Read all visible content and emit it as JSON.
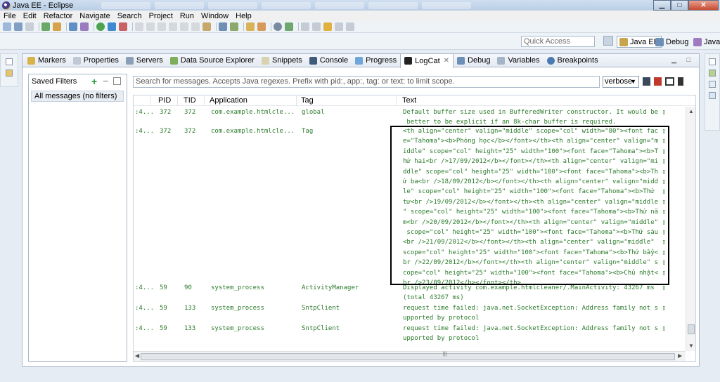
{
  "window": {
    "title": "Java EE - Eclipse",
    "min": "▁",
    "max": "□",
    "close": "✕"
  },
  "menu": [
    "File",
    "Edit",
    "Refactor",
    "Navigate",
    "Search",
    "Project",
    "Run",
    "Window",
    "Help"
  ],
  "toolbar": {
    "quick_access": "Quick Access"
  },
  "perspectives": {
    "javaee": "Java EE",
    "debug": "Debug",
    "java": "Java"
  },
  "view_tabs": [
    "Markers",
    "Properties",
    "Servers",
    "Data Source Explorer",
    "Snippets",
    "Console",
    "Progress",
    "LogCat",
    "Debug",
    "Variables",
    "Breakpoints"
  ],
  "logcat": {
    "saved_filters_label": "Saved Filters",
    "filter_item": "All messages (no filters)",
    "search_placeholder": "Search for messages. Accepts Java regexes. Prefix with pid:, app:, tag: or text: to limit scope.",
    "log_level": "verbose",
    "columns": {
      "pid": "PID",
      "tid": "TID",
      "application": "Application",
      "tag": "Tag",
      "text": "Text"
    },
    "rows": [
      {
        "time": ":4...",
        "pid": "372",
        "tid": "372",
        "app": "com.example.htmlcle...",
        "tag": "global",
        "lines": [
          "Default buffer size used in BufferedWriter constructor. It would be ▯",
          " better to be explicit if an 8k-char buffer is required."
        ]
      },
      {
        "time": ":4...",
        "pid": "372",
        "tid": "372",
        "app": "com.example.htmlcle...",
        "tag": "Tag",
        "lines": [
          "<th align=\"center\" valign=\"middle\" scope=\"col\" width=\"80\"><font fac ▯",
          "e=\"Tahoma\"><b>Phòng học</b></font></th><th align=\"center\" valign=\"m ▯",
          "iddle\" scope=\"col\" height=\"25\" width=\"100\"><font face=\"Tahoma\"><b>T ▯",
          "hứ hai<br />17/09/2012</b></font></th><th align=\"center\" valign=\"mi ▯",
          "ddle\" scope=\"col\" height=\"25\" width=\"100\"><font face=\"Tahoma\"><b>Th ▯",
          "ứ ba<br />18/09/2012</b></font></th><th align=\"center\" valign=\"midd ▯",
          "le\" scope=\"col\" height=\"25\" width=\"100\"><font face=\"Tahoma\"><b>Thứ  ▯",
          "tư<br />19/09/2012</b></font></th><th align=\"center\" valign=\"middle ▯",
          "\" scope=\"col\" height=\"25\" width=\"100\"><font face=\"Tahoma\"><b>Thứ nă ▯",
          "m<br />20/09/2012</b></font></th><th align=\"center\" valign=\"middle\" ▯",
          " scope=\"col\" height=\"25\" width=\"100\"><font face=\"Tahoma\"><b>Thứ sáu ▯",
          "<br />21/09/2012</b></font></th><th align=\"center\" valign=\"middle\"  ▯",
          "scope=\"col\" height=\"25\" width=\"100\"><font face=\"Tahoma\"><b>Thứ bẩy< ▯",
          "br />22/09/2012</b></font></th><th align=\"center\" valign=\"middle\" s ▯",
          "cope=\"col\" height=\"25\" width=\"100\"><font face=\"Tahoma\"><b>Chủ nhật< ▯",
          "br />23/09/2012</b></font></th>"
        ]
      },
      {
        "time": ":4...",
        "pid": "59",
        "tid": "90",
        "app": "system_process",
        "tag": "ActivityManager",
        "lines": [
          "Displayed activity com.example.htmlcleaner/.MainActivity: 43267 ms  ▯",
          "(total 43267 ms)"
        ]
      },
      {
        "time": ":4...",
        "pid": "59",
        "tid": "133",
        "app": "system_process",
        "tag": "SntpClient",
        "lines": [
          "request time failed: java.net.SocketException: Address family not s ▯",
          "upported by protocol"
        ]
      },
      {
        "time": ":4...",
        "pid": "59",
        "tid": "133",
        "app": "system_process",
        "tag": "SntpClient",
        "lines": [
          "request time failed: java.net.SocketException: Address family not s ▯",
          "upported by protocol"
        ]
      }
    ]
  },
  "colors": {
    "log_text": "#2a7a2a",
    "selection_box": "#000000",
    "add_filter": "#1d9a2d"
  }
}
